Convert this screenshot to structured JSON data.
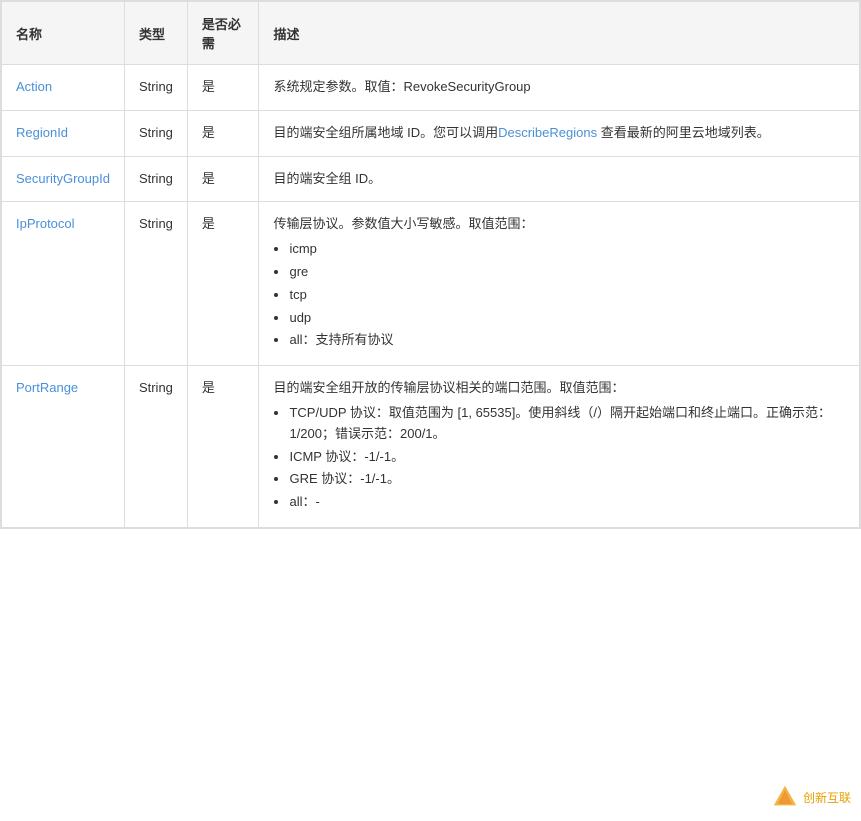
{
  "table": {
    "headers": [
      "名称",
      "类型",
      "是否必需",
      "描述"
    ],
    "rows": [
      {
        "name": "Action",
        "type": "String",
        "required": "是",
        "description_text": "系统规定参数。取值：RevokeSecurityGroup",
        "description_list": []
      },
      {
        "name": "RegionId",
        "type": "String",
        "required": "是",
        "description_text": "目的端安全组所属地域 ID。您可以调用",
        "description_link_text": "DescribeRegions",
        "description_link_suffix": " 查看最新的阿里云地域列表。",
        "description_list": []
      },
      {
        "name": "SecurityGroupId",
        "type": "String",
        "required": "是",
        "description_text": "目的端安全组 ID。",
        "description_list": []
      },
      {
        "name": "IpProtocol",
        "type": "String",
        "required": "是",
        "description_text": "传输层协议。参数值大小写敏感。取值范围：",
        "description_list": [
          "icmp",
          "gre",
          "tcp",
          "udp",
          "all：支持所有协议"
        ]
      },
      {
        "name": "PortRange",
        "type": "String",
        "required": "是",
        "description_text": "目的端安全组开放的传输层协议相关的端口范围。取值范围：",
        "description_list": [
          "TCP/UDP 协议：取值范围为 [1, 65535]。使用斜线（/）隔开起始端口和终止端口。正确示范：1/200；错误示范：200/1。",
          "ICMP 协议：-1/-1。",
          "GRE 协议：-1/-1。",
          "all：-"
        ]
      }
    ]
  },
  "logo": {
    "text": "创新互联"
  }
}
